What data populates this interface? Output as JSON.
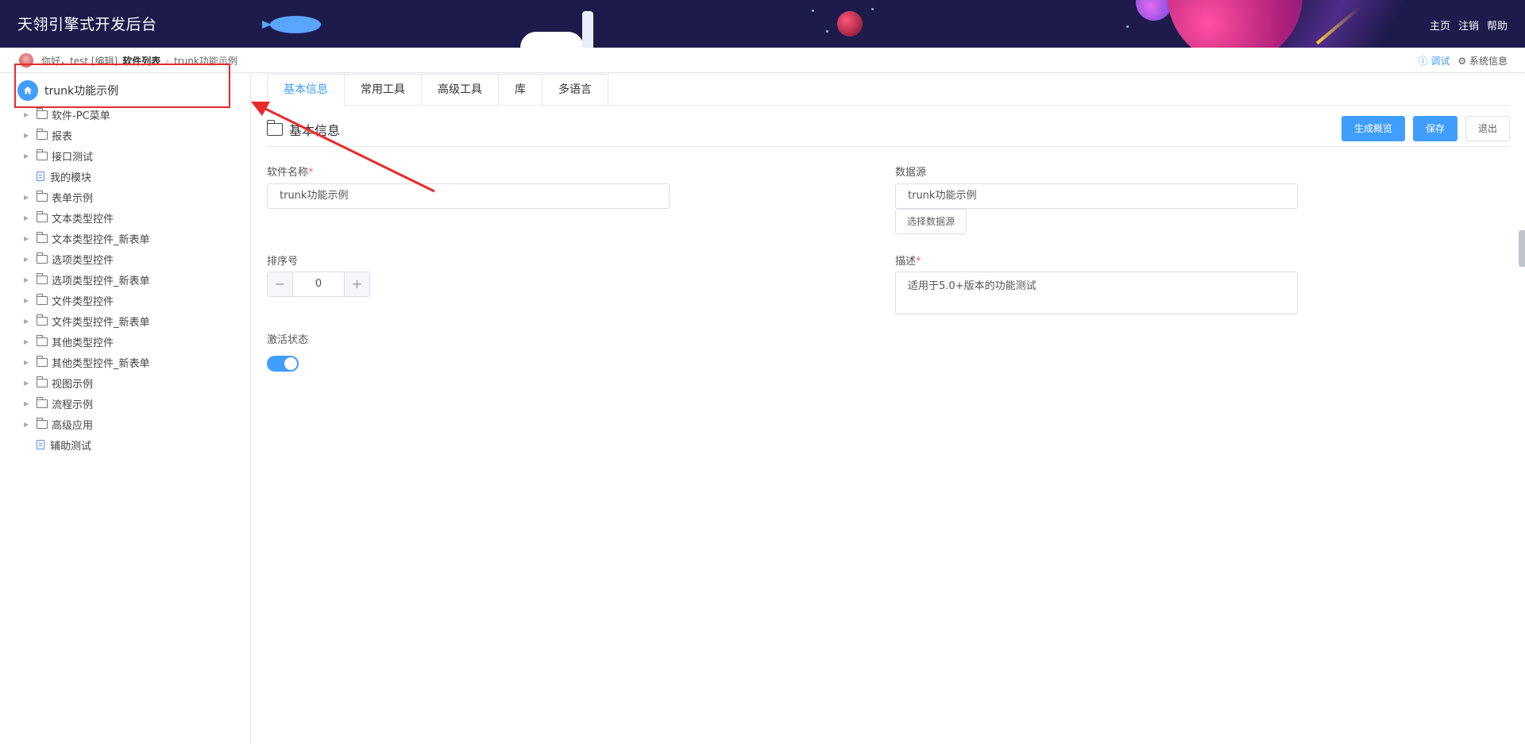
{
  "header": {
    "title": "天翎引擎式开发后台",
    "nav": [
      "主页",
      "注销",
      "帮助"
    ]
  },
  "breadcrumb": {
    "greeting": "你好，test [编辑]",
    "software_list": "软件列表",
    "current": "trunk功能示例",
    "debug": "调试",
    "system_info": "系统信息"
  },
  "sidebar": {
    "root": "trunk功能示例",
    "items": [
      {
        "label": "软件-PC菜单",
        "type": "folder"
      },
      {
        "label": "报表",
        "type": "folder"
      },
      {
        "label": "接口测试",
        "type": "folder"
      },
      {
        "label": "我的模块",
        "type": "doc"
      },
      {
        "label": "表单示例",
        "type": "folder"
      },
      {
        "label": "文本类型控件",
        "type": "folder"
      },
      {
        "label": "文本类型控件_新表单",
        "type": "folder"
      },
      {
        "label": "选项类型控件",
        "type": "folder"
      },
      {
        "label": "选项类型控件_新表单",
        "type": "folder"
      },
      {
        "label": "文件类型控件",
        "type": "folder"
      },
      {
        "label": "文件类型控件_新表单",
        "type": "folder"
      },
      {
        "label": "其他类型控件",
        "type": "folder"
      },
      {
        "label": "其他类型控件_新表单",
        "type": "folder"
      },
      {
        "label": "视图示例",
        "type": "folder"
      },
      {
        "label": "流程示例",
        "type": "folder"
      },
      {
        "label": "高级应用",
        "type": "folder"
      },
      {
        "label": "辅助测试",
        "type": "doc"
      }
    ]
  },
  "tabs": [
    "基本信息",
    "常用工具",
    "高级工具",
    "库",
    "多语言"
  ],
  "section": {
    "title": "基本信息",
    "generate": "生成概览",
    "save": "保存",
    "exit": "退出"
  },
  "form": {
    "name_label": "软件名称",
    "name_value": "trunk功能示例",
    "datasource_label": "数据源",
    "datasource_value": "trunk功能示例",
    "datasource_button": "选择数据源",
    "order_label": "排序号",
    "order_value": "0",
    "desc_label": "描述",
    "desc_value": "适用于5.0+版本的功能测试",
    "active_label": "激活状态",
    "active": true
  },
  "colors": {
    "accent": "#409eff",
    "header_bg": "#1d1b4b",
    "annotation": "#e82a2a"
  }
}
